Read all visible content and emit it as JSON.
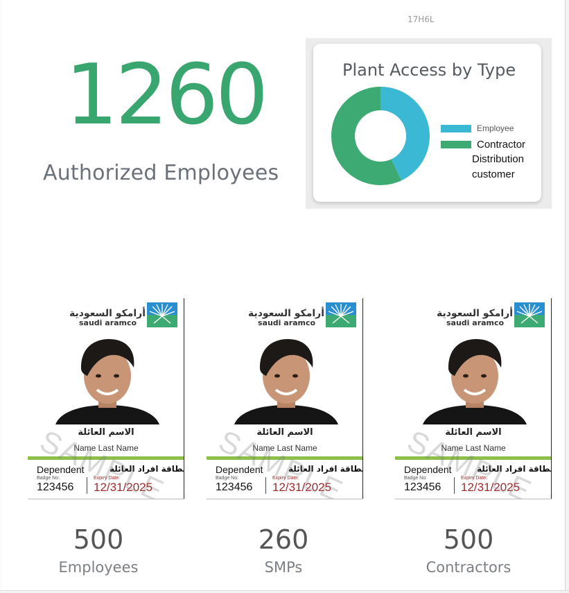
{
  "header": {
    "code": "17H6L"
  },
  "summary": {
    "total": "1260",
    "label": "Authorized Employees"
  },
  "chart": {
    "colors": {
      "employee": "#3bb8d4",
      "contractor": "#3caa72"
    },
    "extra_labels": [
      "Distribution",
      "customer"
    ]
  },
  "chart_data": {
    "type": "pie",
    "title": "Plant Access by Type",
    "categories": [
      "Employee",
      "Contractor"
    ],
    "values": [
      43,
      57
    ],
    "legend": "right"
  },
  "badge_template": {
    "logo_ar": "أرامكو السعودية",
    "logo_en": "saudi aramco",
    "name_ar": "الاسم العائلة",
    "name_en": "Name Last Name",
    "role": "Dependent",
    "role_ar": "بطاقة افراد العائلة",
    "badge_no_label": "Badge No:",
    "badge_no": "123456",
    "expiry_label": "Expiry Date:",
    "expiry": "12/31/2025",
    "watermark": "SAMPLE"
  },
  "stats": [
    {
      "value": "500",
      "label": "Employees"
    },
    {
      "value": "260",
      "label": "SMPs"
    },
    {
      "value": "500",
      "label": "Contractors"
    }
  ]
}
